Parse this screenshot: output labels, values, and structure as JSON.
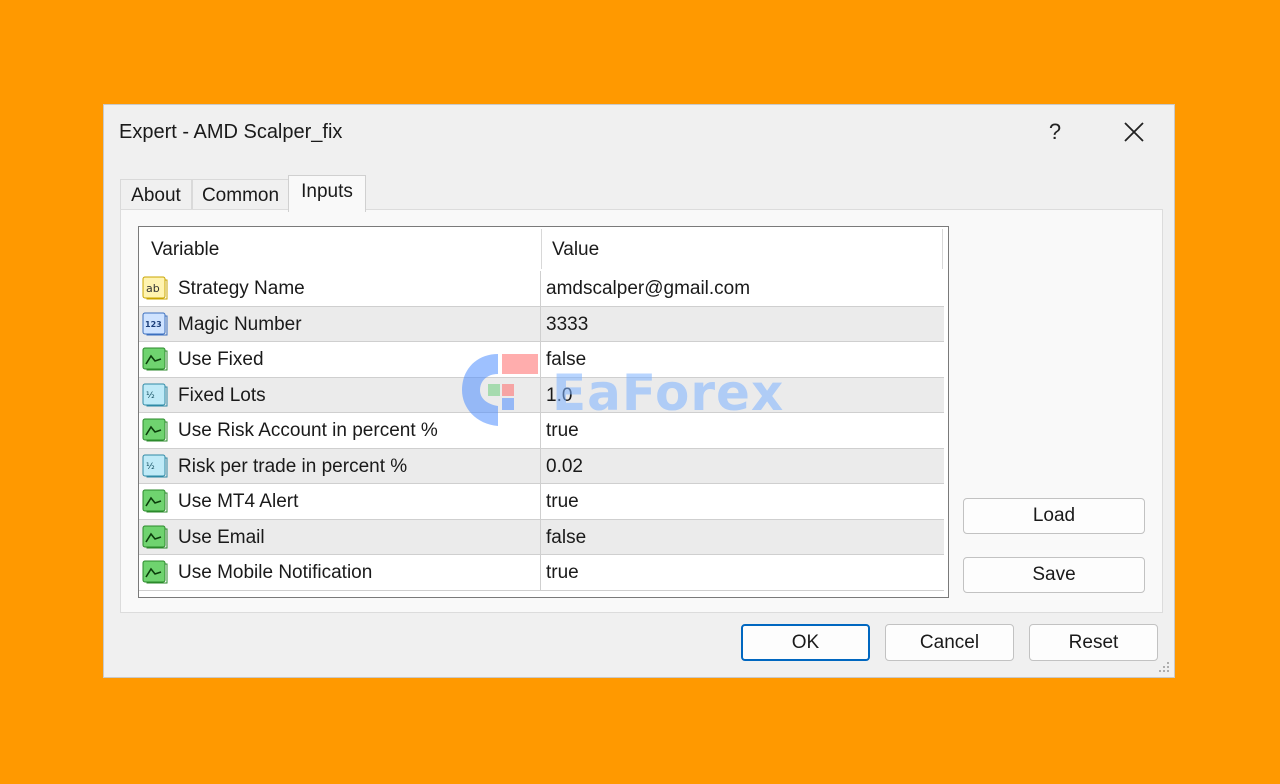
{
  "window": {
    "title": "Expert - AMD Scalper_fix",
    "help_label": "?"
  },
  "tabs": [
    {
      "label": "About"
    },
    {
      "label": "Common"
    },
    {
      "label": "Inputs",
      "active": true
    }
  ],
  "grid": {
    "columns": [
      "Variable",
      "Value"
    ],
    "rows": [
      {
        "icon": "string-icon",
        "variable": "Strategy Name",
        "value": "amdscalper@gmail.com"
      },
      {
        "icon": "integer-icon",
        "variable": "Magic Number",
        "value": "3333"
      },
      {
        "icon": "bool-icon",
        "variable": "Use Fixed",
        "value": "false"
      },
      {
        "icon": "double-icon",
        "variable": "Fixed Lots",
        "value": "1.0"
      },
      {
        "icon": "bool-icon",
        "variable": "Use Risk Account in percent %",
        "value": "true"
      },
      {
        "icon": "double-icon",
        "variable": "Risk per trade in percent %",
        "value": "0.02"
      },
      {
        "icon": "bool-icon",
        "variable": "Use MT4 Alert",
        "value": "true"
      },
      {
        "icon": "bool-icon",
        "variable": "Use Email",
        "value": "false"
      },
      {
        "icon": "bool-icon",
        "variable": "Use Mobile Notification",
        "value": "true"
      }
    ]
  },
  "buttons": {
    "load": "Load",
    "save": "Save",
    "ok": "OK",
    "cancel": "Cancel",
    "reset": "Reset"
  },
  "watermark": {
    "text": "EaForex"
  },
  "colors": {
    "background": "#ff9900",
    "accent": "#0067c0",
    "alt_row": "#ebebeb"
  }
}
